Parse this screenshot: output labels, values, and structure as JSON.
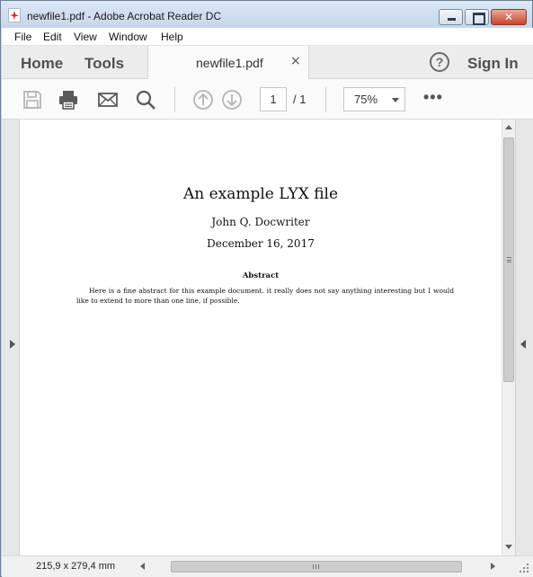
{
  "window": {
    "title": "newfile1.pdf - Adobe Acrobat Reader DC"
  },
  "menu": {
    "items": [
      "File",
      "Edit",
      "View",
      "Window",
      "Help"
    ]
  },
  "topbar": {
    "home": "Home",
    "tools": "Tools",
    "tab_label": "newfile1.pdf",
    "tab_close": "×",
    "help": "?",
    "sign_in": "Sign In"
  },
  "toolbar": {
    "icons": [
      "save-icon",
      "print-icon",
      "email-icon",
      "search-icon",
      "page-up-icon",
      "page-down-icon",
      "more-icon"
    ],
    "current_page": "1",
    "page_total": "/ 1",
    "zoom": "75%",
    "more": "•••"
  },
  "document": {
    "title": "An example LYX file",
    "author": "John Q. Docwriter",
    "date": "December 16, 2017",
    "abstract_heading": "Abstract",
    "abstract_body": "Here is a fine abstract for this example document. it really does not say anything interesting but I would like to extend to more than one line, if possible."
  },
  "status": {
    "page_size": "215,9 x 279,4 mm"
  },
  "colors": {
    "titlebar": "#c5d7ec",
    "close_button": "#c7442d",
    "icon_gray": "#5a5a5a",
    "icon_disabled": "#b5b5b5"
  }
}
